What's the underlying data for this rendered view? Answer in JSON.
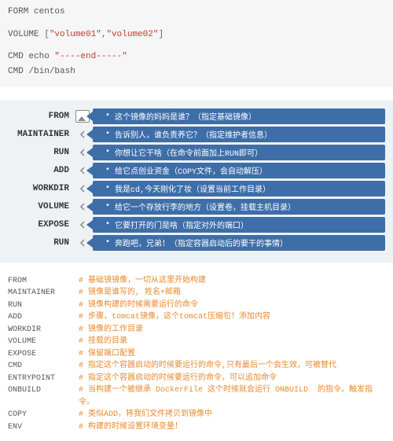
{
  "code": {
    "line1_kw": "FORM",
    "line1_rest": " centos",
    "line2_kw": "VOLUME",
    "line2_punc1": " [",
    "line2_str1": "\"volume01\"",
    "line2_punc2": ",",
    "line2_str2": "\"volume02\"",
    "line2_punc3": "]",
    "line3_kw": "CMD",
    "line3_mid": " echo ",
    "line3_str": "\"----end-----\"",
    "line4_kw": "CMD",
    "line4_rest": " /bin/bash"
  },
  "diagram": [
    {
      "label": "FROM",
      "desc": "这个镜像的妈妈是谁？（指定基础镜像）"
    },
    {
      "label": "MAINTAINER",
      "desc": "告诉别人，谁负责养它？（指定维护者信息）"
    },
    {
      "label": "RUN",
      "desc": "你想让它干啥（在命令前面加上RUN即可）"
    },
    {
      "label": "ADD",
      "desc": "给它点创业资金（COPY文件，会自动解压）"
    },
    {
      "label": "WORKDIR",
      "desc": "我是cd,今天刚化了妆（设置当前工作目录）"
    },
    {
      "label": "VOLUME",
      "desc": "给它一个存放行李的地方（设置卷，挂载主机目录）"
    },
    {
      "label": "EXPOSE",
      "desc": "它要打开的门是啥（指定对外的端口）"
    },
    {
      "label": "RUN",
      "desc": "奔跑吧，兄弟！（指定容器启动后的要干的事情）"
    }
  ],
  "comments": [
    {
      "key": "FROM",
      "com": "# 基础镜镜像，一切从这里开始构建"
    },
    {
      "key": "MAINTAINER",
      "com": "# 镜像是谁写的, 姓名+邮箱"
    },
    {
      "key": "RUN",
      "com": "# 镜像构建的时候需要运行的命令"
    },
    {
      "key": "ADD",
      "com": "# 步骤，tomcat镜像，这个tomcat压缩包！添加内容"
    },
    {
      "key": "WORKDIR",
      "com": "# 镜像的工作目录"
    },
    {
      "key": "VOLUME",
      "com": "# 挂载的目录"
    },
    {
      "key": "EXPOSE",
      "com": "# 保留端口配置"
    },
    {
      "key": "CMD",
      "com": "# 指定这个容器启动的时候要运行的命令,只有最后一个会生效，可被替代"
    },
    {
      "key": "ENTRYPOINT",
      "com": "# 指定这个容器启动的时候要运行的命令，可以追加命令"
    },
    {
      "key": "ONBUILD",
      "com": "# 当构建一个被继承 DockerFile 这个时候就会运行 ONBUILD  的指令。触发指令。"
    },
    {
      "key": "COPY",
      "com": "# 类似ADD，将我们文件拷贝到镜像中"
    },
    {
      "key": "ENV",
      "com": "# 构建的时候设置环境变量！"
    }
  ]
}
